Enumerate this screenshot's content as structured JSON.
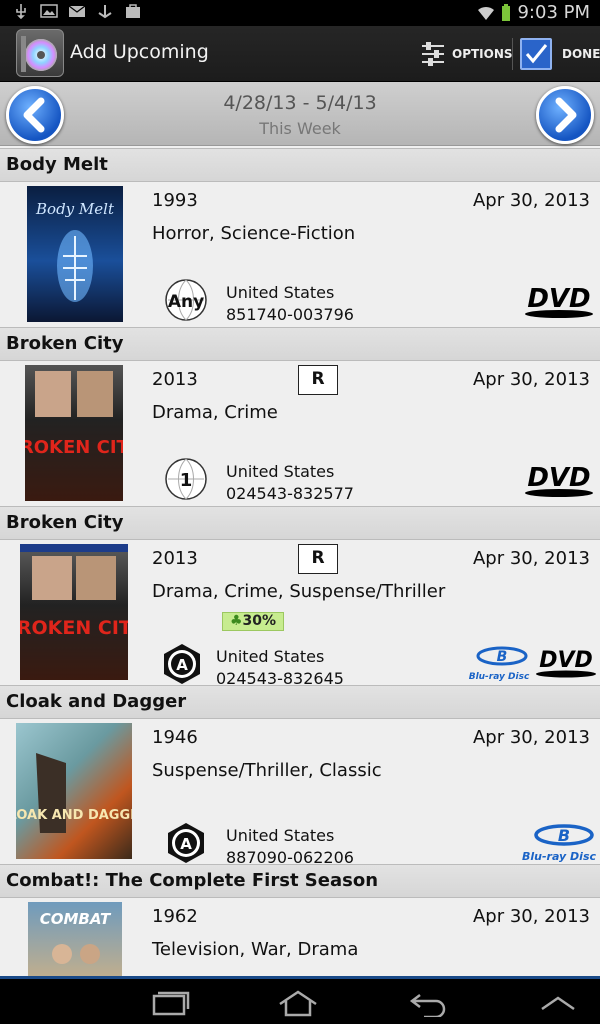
{
  "status_bar": {
    "time": "9:03 PM"
  },
  "action_bar": {
    "title": "Add Upcoming",
    "options_label": "OPTIONS",
    "done_label": "DONE"
  },
  "week_nav": {
    "range": "4/28/13 - 5/4/13",
    "label": "This Week"
  },
  "items": [
    {
      "title": "Body Melt",
      "year": "1993",
      "rating": "",
      "release": "Apr 30, 2013",
      "genres": "Horror, Science-Fiction",
      "region": "Any",
      "country": "United States",
      "upc": "851740-003796",
      "formats": [
        "DVD"
      ],
      "discount": "",
      "cover_text": "Body Melt"
    },
    {
      "title": "Broken City",
      "year": "2013",
      "rating": "R",
      "release": "Apr 30, 2013",
      "genres": "Drama, Crime",
      "region": "1",
      "country": "United States",
      "upc": "024543-832577",
      "formats": [
        "DVD"
      ],
      "discount": "",
      "cover_text": "BROKEN CITY"
    },
    {
      "title": "Broken City",
      "year": "2013",
      "rating": "R",
      "release": "Apr 30, 2013",
      "genres": "Drama, Crime, Suspense/Thriller",
      "region": "A",
      "country": "United States",
      "upc": "024543-832645",
      "formats": [
        "Blu-ray",
        "DVD"
      ],
      "discount": "30%",
      "cover_text": "BROKEN CITY"
    },
    {
      "title": "Cloak and Dagger",
      "year": "1946",
      "rating": "",
      "release": "Apr 30, 2013",
      "genres": "Suspense/Thriller, Classic",
      "region": "A",
      "country": "United States",
      "upc": "887090-062206",
      "formats": [
        "Blu-ray"
      ],
      "discount": "",
      "cover_text": "CLOAK AND DAGGER"
    },
    {
      "title": "Combat!: The Complete First Season",
      "year": "1962",
      "rating": "",
      "release": "Apr 30, 2013",
      "genres": "Television, War, Drama",
      "region": "",
      "country": "",
      "upc": "",
      "formats": [],
      "discount": "",
      "cover_text": "COMBAT"
    }
  ],
  "format_logo_text": {
    "dvd": "DVD",
    "bluray": "Blu-ray Disc"
  },
  "colors": {
    "accent": "#1f6fd6",
    "action_bar": "#1f1f1f",
    "discount": "#c7ec8f"
  },
  "icons": {
    "usb": "usb-icon",
    "image": "image-icon",
    "mail": "mail-icon",
    "wifi": "wifi-icon",
    "battery": "battery-icon"
  }
}
